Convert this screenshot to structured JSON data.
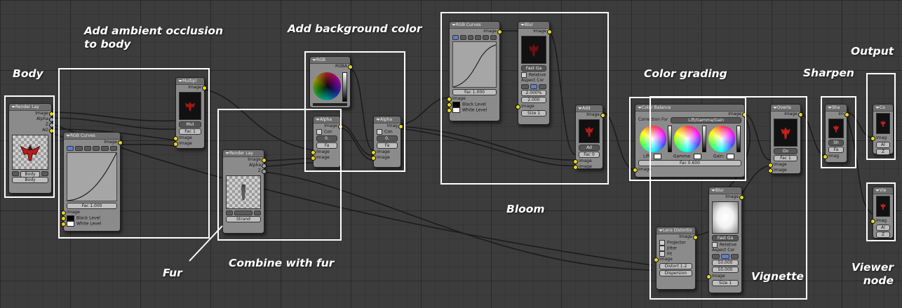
{
  "labels": {
    "body": "Body",
    "ambient_occlusion_line1": "Add ambient occlusion",
    "ambient_occlusion_line2": "to body",
    "background_color": "Add background color",
    "fur": "Fur",
    "combine_with_fur": "Combine with fur",
    "bloom": "Bloom",
    "color_grading": "Color grading",
    "sharpen": "Sharpen",
    "output": "Output",
    "vignette": "Vignette",
    "viewer_node_line1": "Viewer",
    "viewer_node_line2": "node"
  },
  "nodes": {
    "render_layer_body": {
      "title": "Render Lay",
      "outputs": [
        "Image",
        "Alpha",
        "Z",
        "AO"
      ],
      "scene_field": "Body",
      "layer_field": "Body"
    },
    "rgb_curves_ao": {
      "title": "RGB Curves",
      "output": "Image",
      "fac": "Fac 1.000",
      "inputs": [
        "Image",
        "Black Level",
        "White Level"
      ]
    },
    "multiply": {
      "title": "Multipl",
      "output": "Image",
      "mode": "Mul",
      "fac": "Fac 1",
      "inputs": [
        "Image",
        "Image"
      ]
    },
    "render_layer_fur": {
      "title": "Render Lay",
      "outputs": [
        "Image",
        "Alpha",
        "Z"
      ],
      "layer_field": "Strand"
    },
    "alpha_over_fur": {
      "title": "Alpha",
      "output": "Image",
      "con": "Con",
      "value": "0.",
      "fac": "Fa",
      "inputs": [
        "Image",
        "Image"
      ]
    },
    "rgb_bg": {
      "title": "RGB",
      "output": "RGBA"
    },
    "alpha_over_bg": {
      "title": "Alpha",
      "output": "Imag",
      "con": "Con",
      "value": "0.",
      "fac": "Fa",
      "inputs": [
        "Image",
        "Image"
      ]
    },
    "rgb_curves_bloom": {
      "title": "RGB Curves",
      "output": "Image",
      "fac": "Fac 1.000",
      "inputs": [
        "Image",
        "Black Level",
        "White Level"
      ]
    },
    "blur_bloom": {
      "title": "Blur",
      "output": "Image",
      "filter": "Fast Ga",
      "relative": "Relative",
      "aspect": "Aspect Cor",
      "val1": "2.000%",
      "val2": "2.000",
      "input": "Image",
      "size": "Size 1"
    },
    "add_bloom": {
      "title": "Add",
      "output": "Image",
      "mode": "Ad",
      "fac": "Fac 0",
      "inputs": [
        "Image",
        "Image"
      ]
    },
    "color_balance": {
      "title": "Color Balance",
      "output": "Image",
      "correction_label": "Correction For",
      "correction_value": "Lift/Gamma/Gain",
      "lift": "Lift:",
      "gamma": "Gamma:",
      "gain": "Gain:",
      "fac": "Fac 0.600",
      "input": "Image"
    },
    "overlay": {
      "title": "Overla",
      "output": "Image",
      "mode": "Ov",
      "fac": "Fac 1",
      "inputs": [
        "Image",
        "Image"
      ]
    },
    "blur_vignette": {
      "title": "Blur",
      "output": "Image",
      "filter": "Fast Ga",
      "relative": "Relative",
      "aspect": "Aspect Cor",
      "val1": "50.000",
      "val2": "50.000",
      "input": "Image",
      "size": "Size 1"
    },
    "lens_distortion": {
      "title": "Lens Distortio",
      "output": "Image",
      "projector": "Projector",
      "jitter": "Jitter",
      "fit": "Fit",
      "input": "Image",
      "distort": "Distort 1.2",
      "dispersion": "Dispersion"
    },
    "sharpen": {
      "title": "Sha",
      "output": "Im",
      "mode": "Sh",
      "fac": "Fa",
      "input": "Imag"
    },
    "composite": {
      "title": "Co",
      "inputs": [
        "Imag",
        "Al",
        "Z"
      ]
    },
    "viewer": {
      "title": "Vie",
      "inputs": [
        "Imag",
        "Al",
        "Z"
      ]
    }
  },
  "colors": {
    "annotation": "#ffffff",
    "node_body": "#8b8b8b",
    "socket_color": "#e8d81e",
    "socket_value": "#9aa0a8",
    "grid_bg": "#3c3c3c"
  }
}
